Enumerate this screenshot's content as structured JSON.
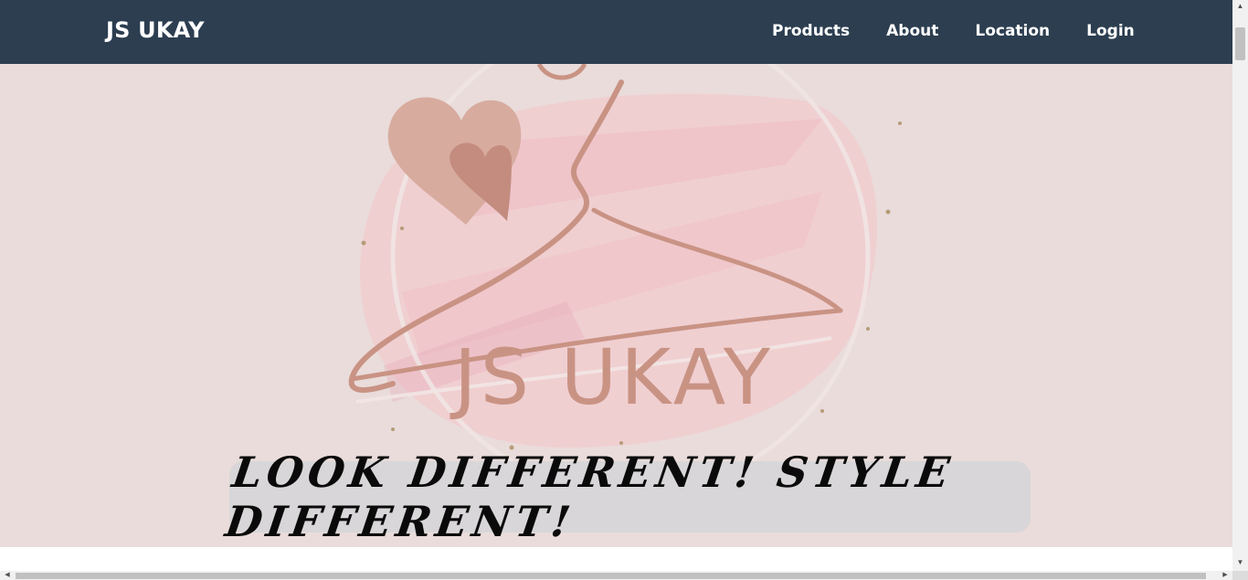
{
  "navbar": {
    "brand": "JS UKAY",
    "links": [
      {
        "label": "Products"
      },
      {
        "label": "About"
      },
      {
        "label": "Location"
      },
      {
        "label": "Login"
      }
    ]
  },
  "hero": {
    "logo_text": "JS UKAY",
    "slogan": "LOOK DIFFERENT! STYLE DIFFERENT!"
  },
  "colors": {
    "navbar_bg": "#2c3e50",
    "hero_bg": "#e9dcda",
    "logo_brown": "#c99384",
    "slogan_box": "#d8d6d8"
  },
  "icons": {
    "scroll_up": "triangle-up",
    "scroll_down": "triangle-down",
    "scroll_left": "triangle-left",
    "scroll_right": "triangle-right"
  }
}
